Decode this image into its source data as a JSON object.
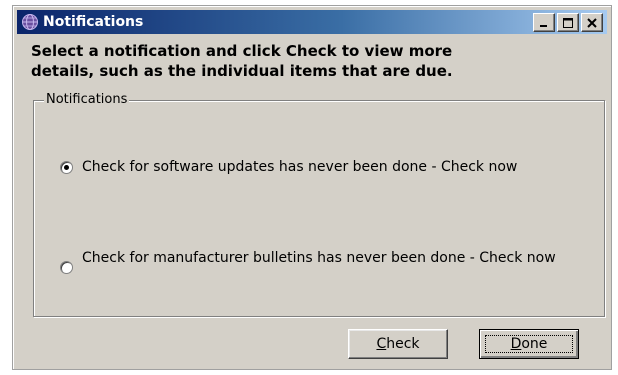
{
  "window": {
    "title": "Notifications",
    "icon": "notification-globe-icon",
    "controls": [
      "minimize-icon",
      "maximize-icon",
      "close-icon"
    ]
  },
  "instructions": {
    "line1": "Select a notification and click Check to view more",
    "line2": "details, such as the individual items that are due."
  },
  "group": {
    "legend": "Notifications",
    "options": [
      {
        "label": "Check for software updates has never been done - Check now",
        "selected": true
      },
      {
        "label": "Check for manufacturer bulletins has never been done - Check now",
        "selected": false
      }
    ]
  },
  "buttons": {
    "check": {
      "mnemonic": "C",
      "rest": "heck"
    },
    "done": {
      "mnemonic": "D",
      "rest": "one"
    }
  },
  "colors": {
    "face": "#d4d0c8",
    "titlebar_start": "#0a246a",
    "titlebar_end": "#a6caf0",
    "title_text": "#ffffff"
  }
}
